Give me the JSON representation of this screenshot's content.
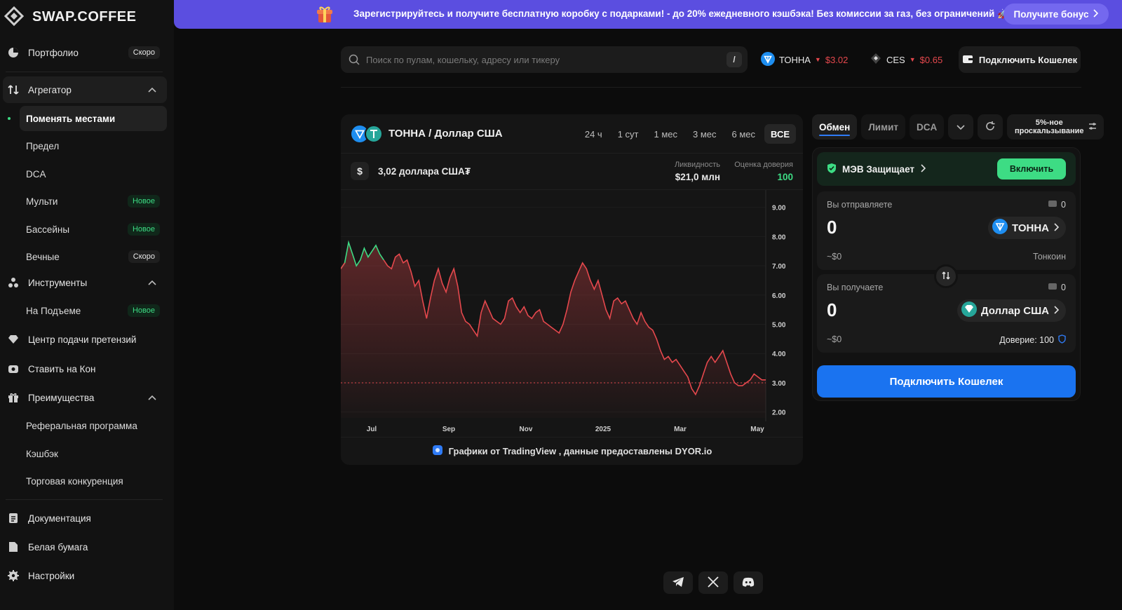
{
  "brand": {
    "name": "SWAP.COFFEE"
  },
  "banner": {
    "text": "Зарегистрируйтесь и получите бесплатную коробку с подарками! - до 20% ежедневного кэшбэка! Без комиссии за газ, без ограничений 🚀",
    "button": "Получите бонус"
  },
  "sidebar": {
    "portfolio": {
      "label": "Портфолио",
      "badge": "Скоро"
    },
    "aggregator": {
      "label": "Агрегатор"
    },
    "aggregator_items": [
      {
        "label": "Поменять местами",
        "badge": ""
      },
      {
        "label": "Предел",
        "badge": ""
      },
      {
        "label": "DCA",
        "badge": ""
      },
      {
        "label": "Мульти",
        "badge": "Новое"
      },
      {
        "label": "Бассейны",
        "badge": "Новое"
      },
      {
        "label": "Вечные",
        "badge": "Скоро"
      }
    ],
    "tools": {
      "label": "Инструменты"
    },
    "tools_items": [
      {
        "label": "На Подъеме",
        "badge": "Новое"
      }
    ],
    "claims": {
      "label": "Центр подачи претензий"
    },
    "stake": {
      "label": "Ставить на Кон"
    },
    "benefits": {
      "label": "Преимущества"
    },
    "benefits_items": [
      {
        "label": "Реферальная программа"
      },
      {
        "label": "Кэшбэк"
      },
      {
        "label": "Торговая конкуренция"
      }
    ],
    "docs": {
      "label": "Документация"
    },
    "whitepaper": {
      "label": "Белая бумага"
    },
    "settings": {
      "label": "Настройки"
    }
  },
  "topbar": {
    "search_placeholder": "Поиск по пулам, кошельку, адресу или тикеру",
    "search_shortcut": "/",
    "tickers": [
      {
        "name": "ТОННА",
        "price": "$3.02"
      },
      {
        "name": "CES",
        "price": "$0.65"
      }
    ],
    "connect": "Подключить Кошелек"
  },
  "chart_card": {
    "pair": "ТОННА / Доллар США",
    "timeframes": [
      "24 ч",
      "1 сут",
      "1 мес",
      "3 мес",
      "6 мес",
      "ВСЕ"
    ],
    "active_timeframe": "ВСЕ",
    "price": "3,02 доллара США₮",
    "liquidity_label": "Ликвидность",
    "liquidity_value": "$21,0 млн",
    "trust_label": "Оценка доверия",
    "trust_value": "100",
    "footer": "Графики от TradingView , данные предоставлены DYOR.io"
  },
  "chart_data": {
    "type": "area",
    "title": "",
    "xlabel": "",
    "ylabel": "",
    "x_ticks": [
      "Jul",
      "Sep",
      "Nov",
      "2025",
      "Mar",
      "May"
    ],
    "y_ticks": [
      "9.00",
      "8.00",
      "7.00",
      "6.00",
      "5.00",
      "4.00",
      "3.00",
      "2.00"
    ],
    "ylim": [
      1.8,
      9.4
    ],
    "current_price_line": 3.0,
    "series": [
      {
        "values": [
          6.9,
          7.1,
          7.8,
          7.4,
          7.0,
          7.2,
          7.6,
          7.3,
          7.5,
          7.7,
          7.4,
          7.2,
          7.0,
          6.9,
          7.3,
          7.4,
          7.1,
          7.2,
          6.8,
          6.3,
          6.5,
          5.8,
          5.2,
          5.9,
          6.5,
          6.9,
          6.4,
          6.1,
          6.6,
          6.9,
          6.3,
          5.4,
          5.1,
          5.0,
          4.8,
          4.6,
          5.4,
          5.8,
          5.5,
          5.2,
          5.1,
          5.0,
          5.2,
          5.8,
          5.9,
          5.6,
          5.4,
          5.6,
          5.3,
          5.2,
          5.4,
          5.5,
          5.1,
          5.0,
          4.9,
          4.8,
          4.7,
          5.0,
          5.5,
          6.1,
          6.5,
          6.8,
          7.1,
          6.9,
          6.5,
          6.2,
          6.5,
          6.0,
          5.5,
          5.2,
          5.8,
          5.9,
          5.7,
          5.8,
          5.5,
          5.2,
          5.0,
          5.4,
          5.1,
          4.9,
          4.8,
          4.5,
          4.1,
          3.8,
          3.9,
          3.7,
          3.8,
          3.6,
          3.4,
          3.2,
          2.8,
          2.6,
          2.9,
          3.3,
          3.7,
          3.9,
          3.7,
          3.9,
          4.1,
          3.7,
          3.3,
          3.0,
          2.9,
          2.9,
          3.0,
          3.1,
          3.3,
          3.2,
          3.1,
          3.1
        ]
      }
    ]
  },
  "swap": {
    "tabs": [
      "Обмен",
      "Лимит",
      "DCA"
    ],
    "active_tab": "Обмен",
    "slippage": "5%-ное проскальзывание",
    "mev_label": "МЭВ Защищает",
    "mev_button": "Включить",
    "send": {
      "label": "Вы отправляете",
      "balance": "0",
      "amount": "0",
      "usd": "~$0",
      "token": "ТОННА",
      "token_name": "Тонкоин"
    },
    "receive": {
      "label": "Вы получаете",
      "balance": "0",
      "amount": "0",
      "usd": "~$0",
      "token": "Доллар США",
      "trust": "Доверие: 100"
    },
    "connect": "Подключить Кошелек"
  },
  "colors": {
    "accent": "#1a73f0",
    "green": "#3ddc84",
    "red": "#e5484d",
    "banner": "#5b4ee0"
  },
  "socials": [
    "telegram-icon",
    "x-icon",
    "discord-icon"
  ]
}
